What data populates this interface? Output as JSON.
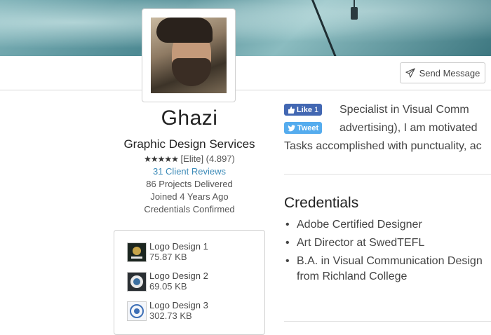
{
  "header": {
    "send_message": "Send Message"
  },
  "profile": {
    "name": "Ghazi",
    "tagline": "Graphic Design Services",
    "stars": "★★★★★",
    "rating_text": "[Elite] (4.897)",
    "reviews": "31 Client Reviews",
    "projects": "86 Projects Delivered",
    "joined": "Joined 4 Years Ago",
    "credentials_status": "Credentials Confirmed"
  },
  "files": [
    {
      "name": "Logo Design 1",
      "size": "75.87 KB"
    },
    {
      "name": "Logo Design 2",
      "size": "69.05 KB"
    },
    {
      "name": "Logo Design 3",
      "size": "302.73 KB"
    }
  ],
  "social": {
    "like_label": "Like",
    "like_count": "1",
    "tweet_label": "Tweet"
  },
  "bio": {
    "line1": "Specialist  in  Visual  Comm",
    "line2": "advertising), I am motivated",
    "line3": "Tasks accomplished with punctuality, ac"
  },
  "credentials": {
    "title": "Credentials",
    "items": [
      "Adobe Certified Designer",
      "Art Director at SwedTEFL",
      "B.A. in Visual Communication Design from Richland College"
    ]
  },
  "colors": {
    "link": "#3d8bb8",
    "facebook": "#4267b2",
    "twitter": "#55acee"
  }
}
